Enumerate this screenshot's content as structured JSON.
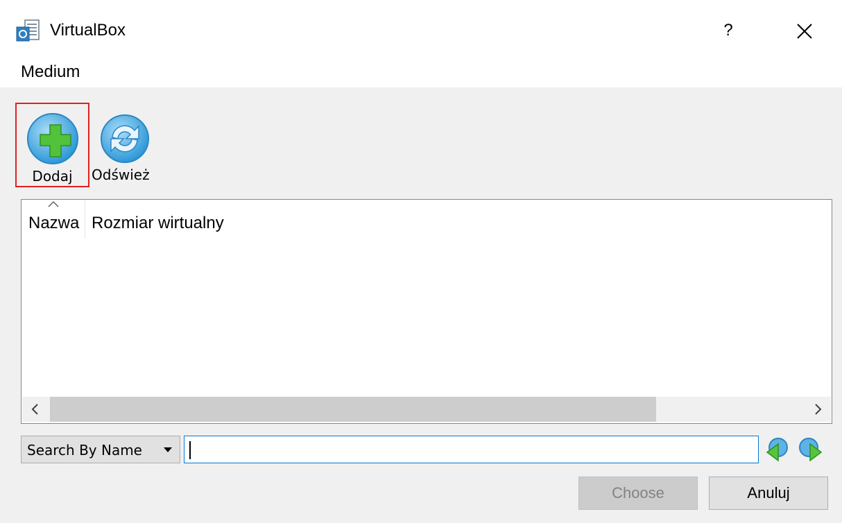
{
  "window": {
    "title": "VirtualBox",
    "help_label": "?",
    "close_icon": "close-icon",
    "app_icon": "virtualbox-app-icon"
  },
  "dialog": {
    "caption": "Medium"
  },
  "toolbar": {
    "items": [
      {
        "label": "Dodaj",
        "icon": "add-disk-icon",
        "highlighted": true
      },
      {
        "label": "Odśwież",
        "icon": "refresh-icon",
        "highlighted": false
      }
    ]
  },
  "table": {
    "columns": [
      {
        "label": "Nazwa",
        "sorted": "ascending"
      },
      {
        "label": "Rozmiar wirtualny"
      }
    ],
    "rows": []
  },
  "search": {
    "mode": "Search By Name",
    "value": "",
    "prev_icon": "search-previous-icon",
    "next_icon": "search-next-icon"
  },
  "buttons": {
    "choose": "Choose",
    "cancel": "Anuluj"
  },
  "colors": {
    "highlight_border": "#e02020",
    "focus_border": "#0078d7",
    "panel_bg": "#f0f0f0",
    "icon_blue": "#3aa3e3",
    "icon_green": "#4fc33c"
  }
}
